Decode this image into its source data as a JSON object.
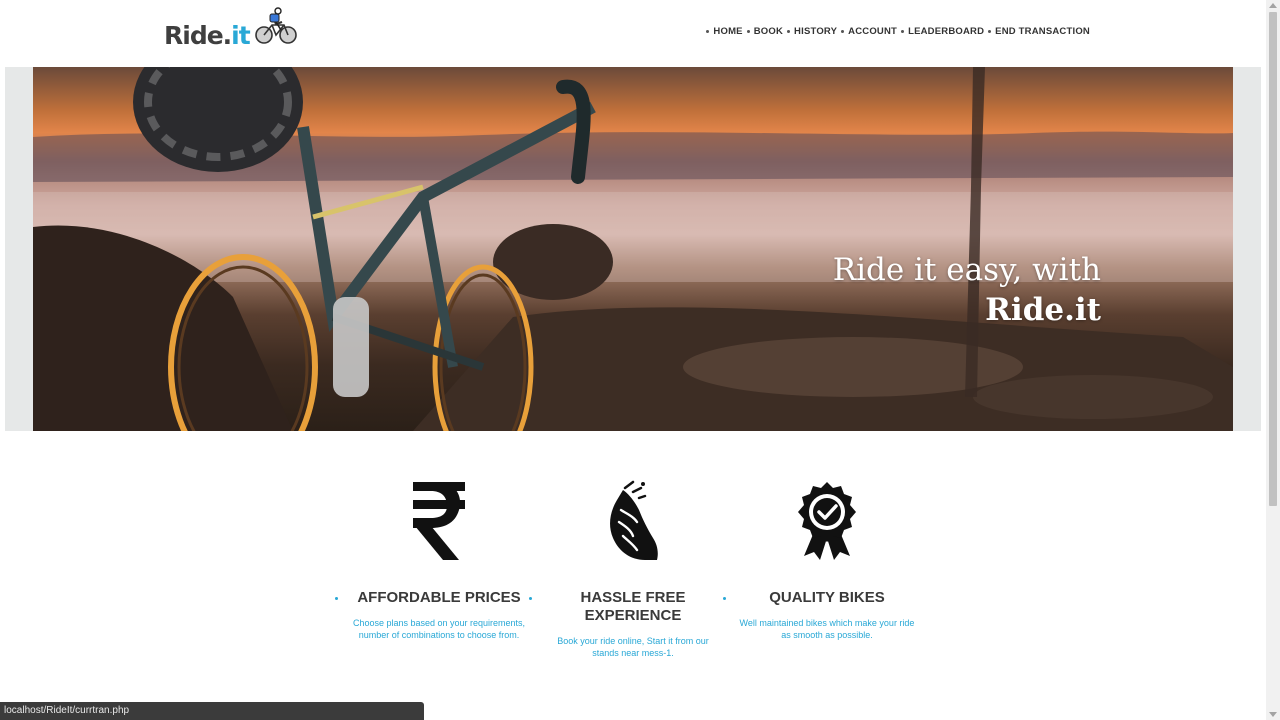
{
  "header": {
    "logo": {
      "text_main": "Ride",
      "text_dot": ".",
      "text_it": "it"
    },
    "nav": [
      {
        "label": "HOME"
      },
      {
        "label": "BOOK"
      },
      {
        "label": "HISTORY"
      },
      {
        "label": "ACCOUNT"
      },
      {
        "label": "LEADERBOARD"
      },
      {
        "label": "END TRANSACTION"
      }
    ]
  },
  "hero": {
    "line1": "Ride it easy, with",
    "line2": "Ride.it"
  },
  "features": [
    {
      "icon": "rupee-icon",
      "title": "AFFORDABLE PRICES",
      "desc_line1": "Choose plans based on your requirements,",
      "desc_line2": "number of combinations to choose from."
    },
    {
      "icon": "relaxed-hand-icon",
      "title_line1": "HASSLE FREE",
      "title_line2": "EXPERIENCE",
      "desc_line1": "Book your ride online, Start it from our",
      "desc_line2": "stands near mess-1."
    },
    {
      "icon": "quality-badge-icon",
      "title": "QUALITY BIKES",
      "desc_line1": "Well maintained bikes which make your ride",
      "desc_line2": "as smooth as possible."
    }
  ],
  "statusbar": {
    "url": "localhost/RideIt/currtran.php"
  },
  "colors": {
    "accent": "#29a8d6",
    "text_dark": "#3a3a3a",
    "statusbar_bg": "#3b3b3b"
  }
}
